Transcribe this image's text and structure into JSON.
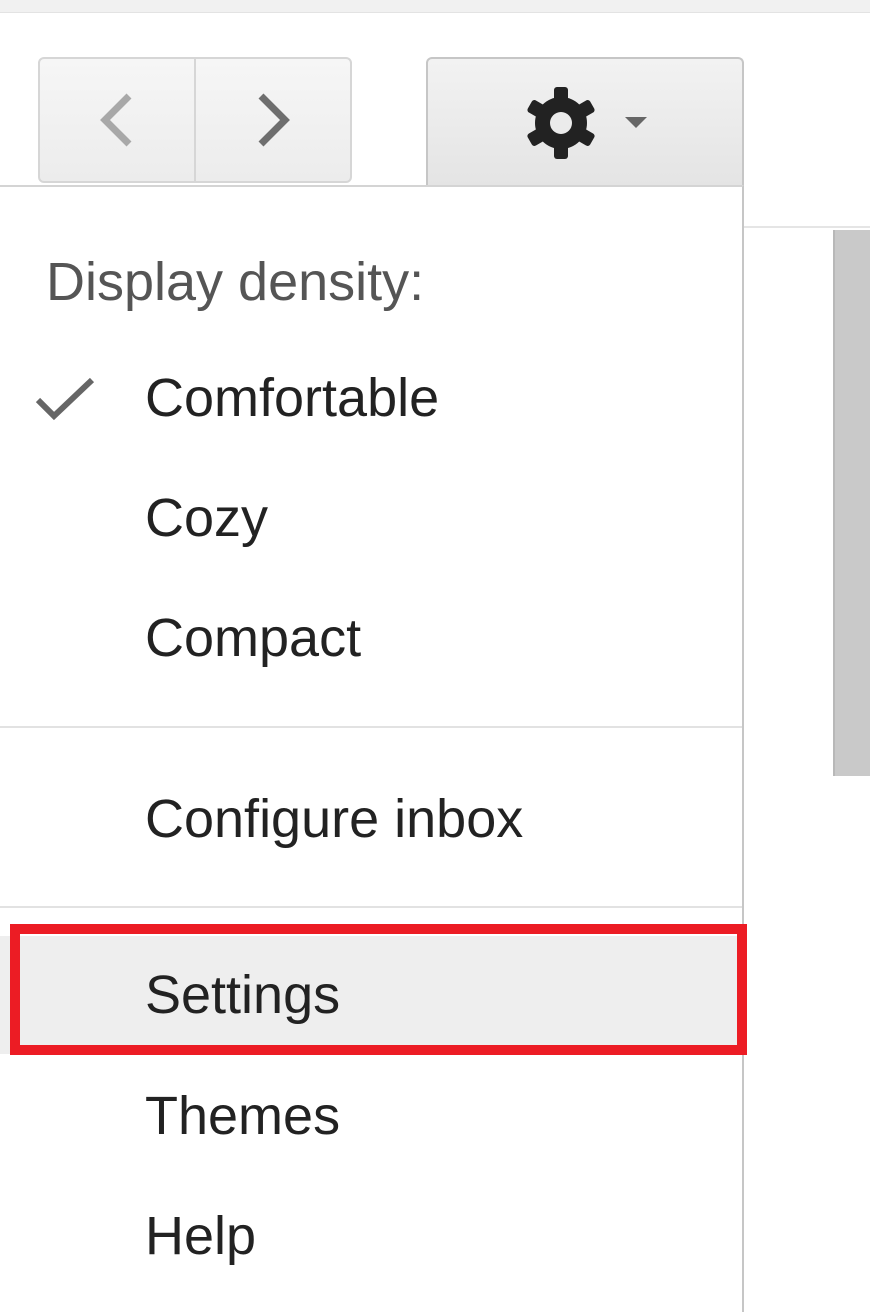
{
  "toolbar": {
    "prev_icon": "chevron-left-icon",
    "next_icon": "chevron-right-icon",
    "settings_icon": "gear-icon",
    "dropdown_icon": "caret-down-icon"
  },
  "menu": {
    "heading": "Display density:",
    "density_options": [
      {
        "label": "Comfortable",
        "checked": true
      },
      {
        "label": "Cozy",
        "checked": false
      },
      {
        "label": "Compact",
        "checked": false
      }
    ],
    "configure_inbox": "Configure inbox",
    "settings": "Settings",
    "themes": "Themes",
    "help": "Help"
  },
  "colors": {
    "highlight_border": "#ec1c24",
    "hover_background": "#eeeeee",
    "text": "#222222",
    "heading_text": "#555555"
  }
}
